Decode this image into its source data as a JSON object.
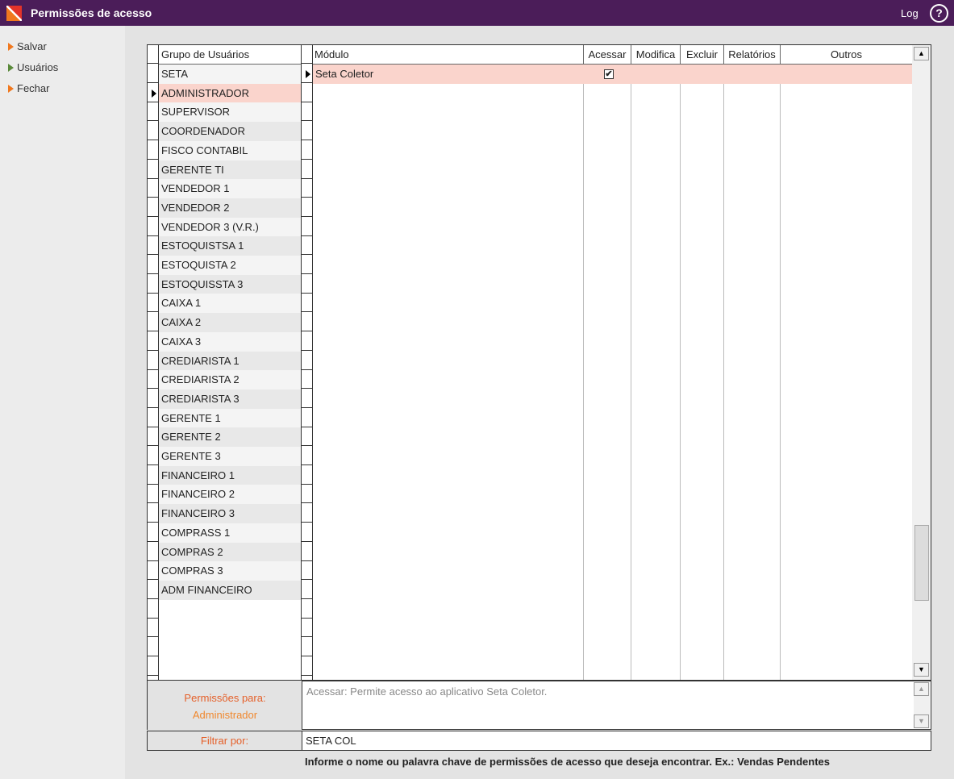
{
  "window": {
    "title": "Permissões de acesso",
    "log_label": "Log",
    "help_symbol": "?"
  },
  "sidebar": {
    "items": [
      {
        "label": "Salvar",
        "icon": "orange-triangle-icon"
      },
      {
        "label": "Usuários",
        "icon": "green-triangle-icon"
      },
      {
        "label": "Fechar",
        "icon": "orange-triangle-icon"
      }
    ]
  },
  "groups_grid": {
    "header": "Grupo de Usuários",
    "selected_index": 1,
    "rows": [
      "SETA",
      "ADMINISTRADOR",
      "SUPERVISOR",
      "COORDENADOR",
      "FISCO CONTABIL",
      "GERENTE TI",
      "VENDEDOR 1",
      "VENDEDOR 2",
      "VENDEDOR 3 (V.R.)",
      "ESTOQUISTSA 1",
      "ESTOQUISTA 2",
      "ESTOQUISSTA 3",
      "CAIXA 1",
      "CAIXA 2",
      "CAIXA 3",
      "CREDIARISTA 1",
      "CREDIARISTA 2",
      "CREDIARISTA 3",
      "GERENTE 1",
      "GERENTE 2",
      "GERENTE 3",
      "FINANCEIRO 1",
      "FINANCEIRO 2",
      "FINANCEIRO 3",
      "COMPRASS 1",
      "COMPRAS 2",
      "COMPRAS 3",
      "ADM FINANCEIRO"
    ]
  },
  "permissions_grid": {
    "columns": [
      "Módulo",
      "Acessar",
      "Modifica",
      "Excluir",
      "Relatórios",
      "Outros"
    ],
    "rows": [
      {
        "modulo": "Seta Coletor",
        "acessar": true,
        "modifica": false,
        "excluir": false,
        "relatorios": false,
        "outros": ""
      }
    ]
  },
  "permissions_for": {
    "label": "Permissões para:",
    "group": "Administrador"
  },
  "description": "Acessar: Permite acesso ao aplicativo Seta Coletor.",
  "filter": {
    "label": "Filtrar por:",
    "value": "SETA COL"
  },
  "hint": "Informe o nome ou palavra chave de permissões de acesso que deseja encontrar. Ex.: Vendas Pendentes",
  "colors": {
    "titlebar": "#4b1d59",
    "accent_orange": "#f0781e",
    "selection": "#fad4cc",
    "label_orange": "#e5602a"
  }
}
